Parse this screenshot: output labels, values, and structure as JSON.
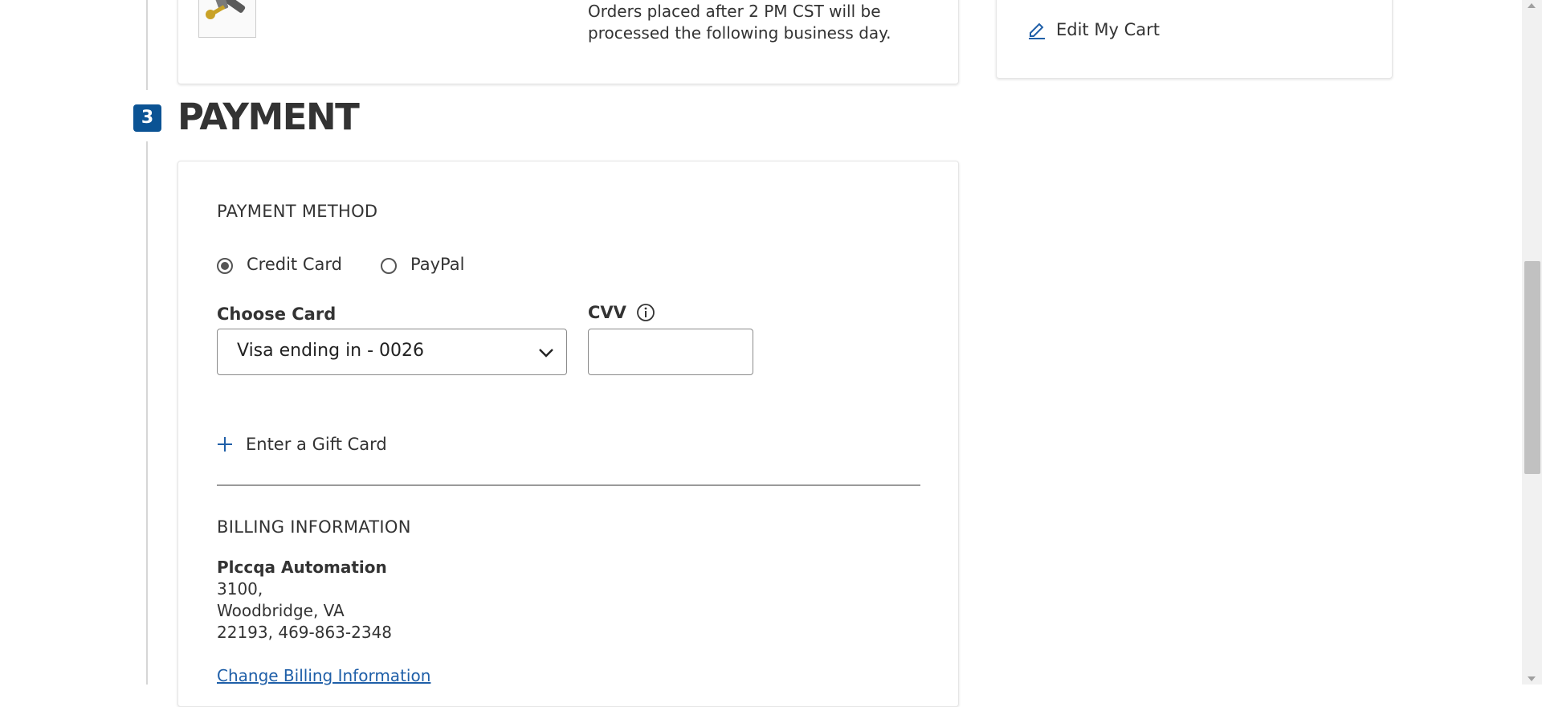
{
  "colors": {
    "accent": "#0b5394",
    "link": "#1f5fa8",
    "text": "#333333"
  },
  "shipping": {
    "note_line1": "Orders placed after 2 PM CST will be",
    "note_line2": "processed the following business day."
  },
  "summary": {
    "edit_cart_label": "Edit My Cart"
  },
  "payment": {
    "step_number": "3",
    "title": "PAYMENT",
    "method_heading": "PAYMENT METHOD",
    "options": {
      "credit_card": "Credit Card",
      "paypal": "PayPal"
    },
    "selected_option": "Credit Card",
    "choose_card_label": "Choose Card",
    "selected_card": "Visa ending in - 0026",
    "cvv_label": "CVV",
    "cvv_value": "",
    "gift_card_label": "Enter a Gift Card"
  },
  "billing": {
    "heading": "BILLING INFORMATION",
    "name": "Plccqa Automation",
    "line1": "3100,",
    "line2": "Woodbridge, VA",
    "line3": "22193, 469-863-2348",
    "change_link": "Change Billing Information"
  },
  "icons": [
    "product-thumbnail",
    "pencil-icon",
    "info-icon",
    "chevron-down-icon",
    "plus-icon"
  ]
}
